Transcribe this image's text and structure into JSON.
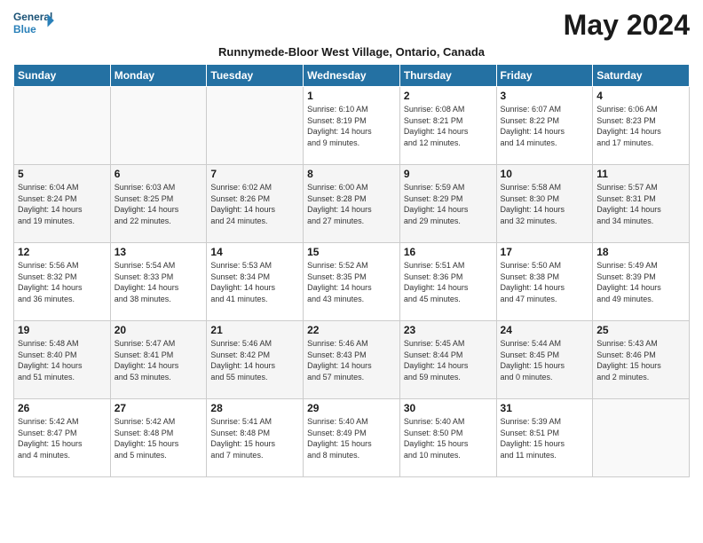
{
  "logo": {
    "line1": "General",
    "line2": "Blue"
  },
  "title": "May 2024",
  "subtitle": "Runnymede-Bloor West Village, Ontario, Canada",
  "days_of_week": [
    "Sunday",
    "Monday",
    "Tuesday",
    "Wednesday",
    "Thursday",
    "Friday",
    "Saturday"
  ],
  "weeks": [
    [
      {
        "day": "",
        "info": ""
      },
      {
        "day": "",
        "info": ""
      },
      {
        "day": "",
        "info": ""
      },
      {
        "day": "1",
        "info": "Sunrise: 6:10 AM\nSunset: 8:19 PM\nDaylight: 14 hours\nand 9 minutes."
      },
      {
        "day": "2",
        "info": "Sunrise: 6:08 AM\nSunset: 8:21 PM\nDaylight: 14 hours\nand 12 minutes."
      },
      {
        "day": "3",
        "info": "Sunrise: 6:07 AM\nSunset: 8:22 PM\nDaylight: 14 hours\nand 14 minutes."
      },
      {
        "day": "4",
        "info": "Sunrise: 6:06 AM\nSunset: 8:23 PM\nDaylight: 14 hours\nand 17 minutes."
      }
    ],
    [
      {
        "day": "5",
        "info": "Sunrise: 6:04 AM\nSunset: 8:24 PM\nDaylight: 14 hours\nand 19 minutes."
      },
      {
        "day": "6",
        "info": "Sunrise: 6:03 AM\nSunset: 8:25 PM\nDaylight: 14 hours\nand 22 minutes."
      },
      {
        "day": "7",
        "info": "Sunrise: 6:02 AM\nSunset: 8:26 PM\nDaylight: 14 hours\nand 24 minutes."
      },
      {
        "day": "8",
        "info": "Sunrise: 6:00 AM\nSunset: 8:28 PM\nDaylight: 14 hours\nand 27 minutes."
      },
      {
        "day": "9",
        "info": "Sunrise: 5:59 AM\nSunset: 8:29 PM\nDaylight: 14 hours\nand 29 minutes."
      },
      {
        "day": "10",
        "info": "Sunrise: 5:58 AM\nSunset: 8:30 PM\nDaylight: 14 hours\nand 32 minutes."
      },
      {
        "day": "11",
        "info": "Sunrise: 5:57 AM\nSunset: 8:31 PM\nDaylight: 14 hours\nand 34 minutes."
      }
    ],
    [
      {
        "day": "12",
        "info": "Sunrise: 5:56 AM\nSunset: 8:32 PM\nDaylight: 14 hours\nand 36 minutes."
      },
      {
        "day": "13",
        "info": "Sunrise: 5:54 AM\nSunset: 8:33 PM\nDaylight: 14 hours\nand 38 minutes."
      },
      {
        "day": "14",
        "info": "Sunrise: 5:53 AM\nSunset: 8:34 PM\nDaylight: 14 hours\nand 41 minutes."
      },
      {
        "day": "15",
        "info": "Sunrise: 5:52 AM\nSunset: 8:35 PM\nDaylight: 14 hours\nand 43 minutes."
      },
      {
        "day": "16",
        "info": "Sunrise: 5:51 AM\nSunset: 8:36 PM\nDaylight: 14 hours\nand 45 minutes."
      },
      {
        "day": "17",
        "info": "Sunrise: 5:50 AM\nSunset: 8:38 PM\nDaylight: 14 hours\nand 47 minutes."
      },
      {
        "day": "18",
        "info": "Sunrise: 5:49 AM\nSunset: 8:39 PM\nDaylight: 14 hours\nand 49 minutes."
      }
    ],
    [
      {
        "day": "19",
        "info": "Sunrise: 5:48 AM\nSunset: 8:40 PM\nDaylight: 14 hours\nand 51 minutes."
      },
      {
        "day": "20",
        "info": "Sunrise: 5:47 AM\nSunset: 8:41 PM\nDaylight: 14 hours\nand 53 minutes."
      },
      {
        "day": "21",
        "info": "Sunrise: 5:46 AM\nSunset: 8:42 PM\nDaylight: 14 hours\nand 55 minutes."
      },
      {
        "day": "22",
        "info": "Sunrise: 5:46 AM\nSunset: 8:43 PM\nDaylight: 14 hours\nand 57 minutes."
      },
      {
        "day": "23",
        "info": "Sunrise: 5:45 AM\nSunset: 8:44 PM\nDaylight: 14 hours\nand 59 minutes."
      },
      {
        "day": "24",
        "info": "Sunrise: 5:44 AM\nSunset: 8:45 PM\nDaylight: 15 hours\nand 0 minutes."
      },
      {
        "day": "25",
        "info": "Sunrise: 5:43 AM\nSunset: 8:46 PM\nDaylight: 15 hours\nand 2 minutes."
      }
    ],
    [
      {
        "day": "26",
        "info": "Sunrise: 5:42 AM\nSunset: 8:47 PM\nDaylight: 15 hours\nand 4 minutes."
      },
      {
        "day": "27",
        "info": "Sunrise: 5:42 AM\nSunset: 8:48 PM\nDaylight: 15 hours\nand 5 minutes."
      },
      {
        "day": "28",
        "info": "Sunrise: 5:41 AM\nSunset: 8:48 PM\nDaylight: 15 hours\nand 7 minutes."
      },
      {
        "day": "29",
        "info": "Sunrise: 5:40 AM\nSunset: 8:49 PM\nDaylight: 15 hours\nand 8 minutes."
      },
      {
        "day": "30",
        "info": "Sunrise: 5:40 AM\nSunset: 8:50 PM\nDaylight: 15 hours\nand 10 minutes."
      },
      {
        "day": "31",
        "info": "Sunrise: 5:39 AM\nSunset: 8:51 PM\nDaylight: 15 hours\nand 11 minutes."
      },
      {
        "day": "",
        "info": ""
      }
    ]
  ]
}
